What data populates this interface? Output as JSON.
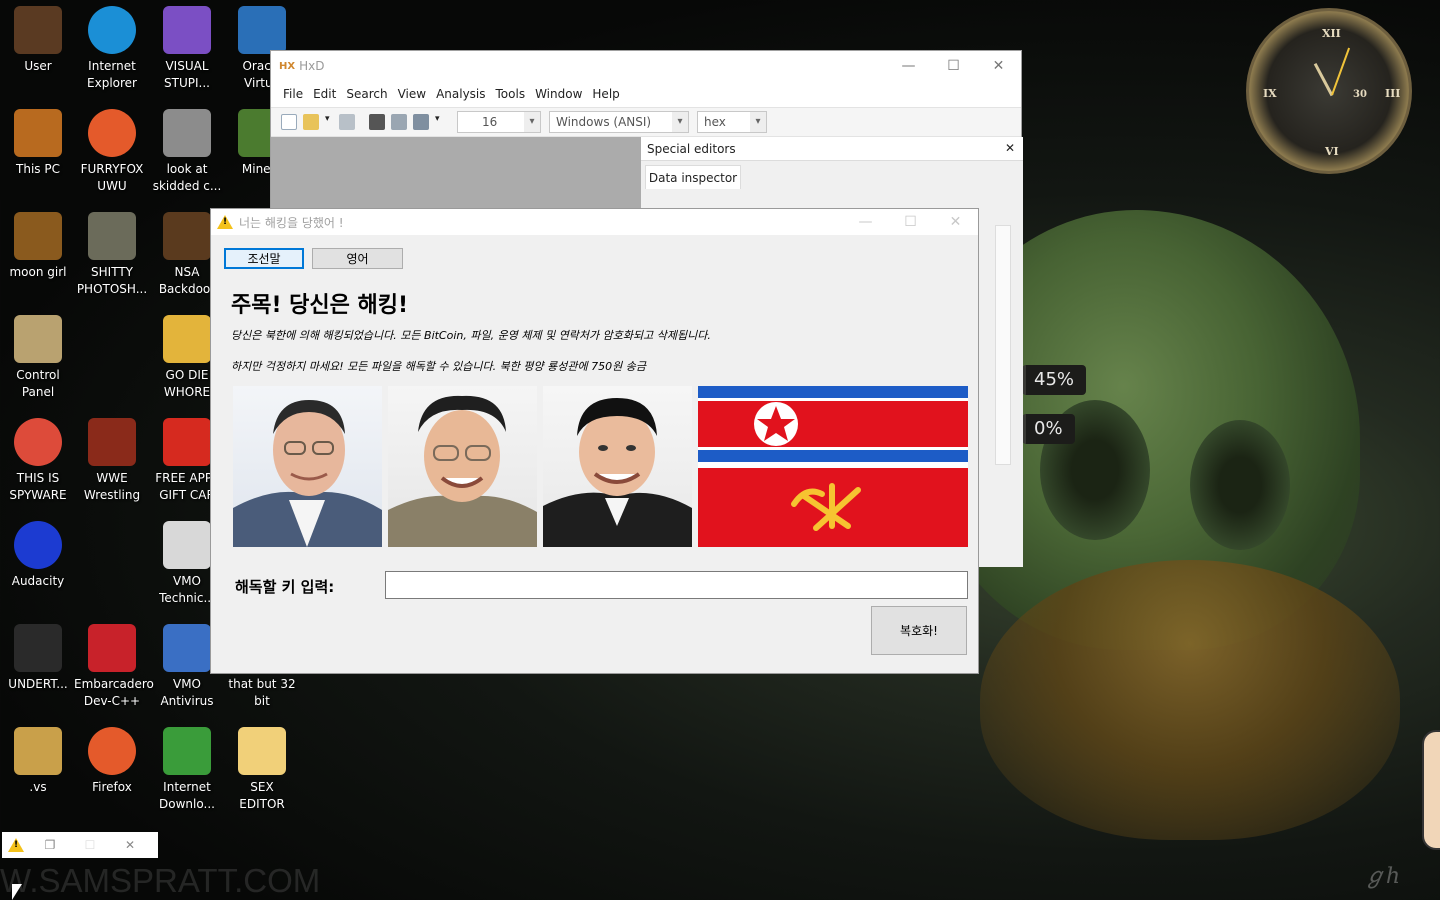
{
  "desktop_icons": [
    {
      "label": "User",
      "icon": "user-folder-icon",
      "color": "#5a3a22"
    },
    {
      "label": "Internet\nExplorer",
      "icon": "edge-icon",
      "color": "#1b8fd6"
    },
    {
      "label": "VISUAL\nSTUPI...",
      "icon": "visual-studio-icon",
      "color": "#7b4fc4"
    },
    {
      "label": "Oracle\nVirtua",
      "icon": "virtualbox-icon",
      "color": "#2a6fb7"
    },
    {
      "label": "This PC",
      "icon": "computer-icon",
      "color": "#b86a1f"
    },
    {
      "label": "FURRYFOX\nUWU",
      "icon": "firefox-icon",
      "color": "#e45a2b"
    },
    {
      "label": "look at\nskidded c...",
      "icon": "copy-windows-icon",
      "color": "#8c8c8c"
    },
    {
      "label": "Minecr",
      "icon": "minecraft-icon",
      "color": "#4b7b2f"
    },
    {
      "label": "moon girl",
      "icon": "folder-icon",
      "color": "#8a5a1e"
    },
    {
      "label": "SHITTY\nPHOTOSH...",
      "icon": "gimp-icon",
      "color": "#6b6b5a"
    },
    {
      "label": "NSA\nBackdoor",
      "icon": "vault-icon",
      "color": "#5a3a1e"
    },
    {
      "label": "Control\nPanel",
      "icon": "lightbulb-icon",
      "color": "#b9a270"
    },
    {
      "label": "GO DIE\nWHORE",
      "icon": "de-icon",
      "color": "#e3b43b"
    },
    {
      "label": "THIS IS\nSPYWARE",
      "icon": "chrome-icon",
      "color": "#dd4b3a"
    },
    {
      "label": "WWE\nWrestling",
      "icon": "wwe-icon",
      "color": "#8a2a1a"
    },
    {
      "label": "FREE APPL\nGIFT CAR",
      "icon": "apple-icon",
      "color": "#d62a1f"
    },
    {
      "label": "Audacity",
      "icon": "audacity-icon",
      "color": "#1c3bd1"
    },
    {
      "label": "VMO\nTechnic...",
      "icon": "technician-icon",
      "color": "#d8d8d8"
    },
    {
      "label": "UNDERT...",
      "icon": "unity-icon",
      "color": "#2a2a2a"
    },
    {
      "label": "Embarcadero\nDev-C++",
      "icon": "devcpp-icon",
      "color": "#c8222a"
    },
    {
      "label": "VMO\nAntivirus",
      "icon": "shield-icon",
      "color": "#3a6fc4"
    },
    {
      "label": "that but 32\nbit",
      "icon": "blank-icon",
      "color": "#000000"
    },
    {
      "label": ".vs",
      "icon": "folder-icon",
      "color": "#c9a04a"
    },
    {
      "label": "Firefox",
      "icon": "firefox-icon",
      "color": "#e45a2b"
    },
    {
      "label": "Internet\nDownlo...",
      "icon": "idm-icon",
      "color": "#3a9c3a"
    },
    {
      "label": "SEX\nEDITOR",
      "icon": "hxd-icon",
      "color": "#f1d079"
    }
  ],
  "hxd": {
    "title": "HxD",
    "menus": [
      "File",
      "Edit",
      "Search",
      "View",
      "Analysis",
      "Tools",
      "Window",
      "Help"
    ],
    "bytes_per_row": "16",
    "charset": "Windows (ANSI)",
    "offset_base": "hex",
    "panel_title": "Special editors",
    "panel_tab": "Data inspector"
  },
  "dialog": {
    "title": "너는 해킹을 당했어 !",
    "lang_buttons": [
      "조선말",
      "영어"
    ],
    "heading": "주목! 당신은 해킹!",
    "message1": "당신은 북한에 의해 해킹되었습니다. 모든 BitCoin, 파일, 운영 체제 및 연락처가 암호화되고 삭제됩니다.",
    "message2": "하지만 걱정하지 마세요! 모든 파일을 해독할 수 있습니다. 북한 평양 룡성관에 750원 송금",
    "key_label": "해독할 키 입력:",
    "key_value": "",
    "decrypt_button": "복호화!"
  },
  "wallpaper": {
    "gauge_top": "45%",
    "gauge_bottom": "0%",
    "watermark": "W.SAMSPRATT.COM",
    "clock_numerals": [
      "XII",
      "III",
      "VI",
      "IX",
      "30"
    ]
  },
  "colors": {
    "nk_red": "#e1121d",
    "nk_blue": "#1d5cc6",
    "selection_blue": "#0078d7"
  }
}
